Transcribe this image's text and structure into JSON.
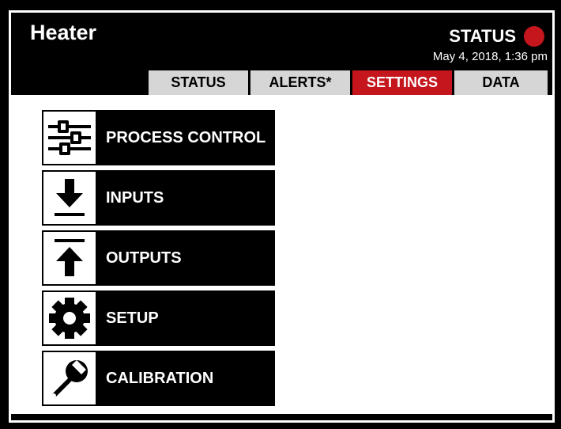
{
  "header": {
    "title": "Heater",
    "status_label": "STATUS",
    "status_color": "#c4161c",
    "datetime": "May 4, 2018, 1:36 pm"
  },
  "tabs": [
    {
      "label": "STATUS",
      "active": false
    },
    {
      "label": "ALERTS*",
      "active": false
    },
    {
      "label": "SETTINGS",
      "active": true
    },
    {
      "label": "DATA",
      "active": false
    }
  ],
  "menu": [
    {
      "label": "PROCESS CONTROL",
      "icon": "sliders-icon"
    },
    {
      "label": "INPUTS",
      "icon": "download-arrow-icon"
    },
    {
      "label": "OUTPUTS",
      "icon": "upload-arrow-icon"
    },
    {
      "label": "SETUP",
      "icon": "gear-icon"
    },
    {
      "label": "CALIBRATION",
      "icon": "wrench-icon"
    }
  ],
  "colors": {
    "accent": "#c4161c",
    "tab_inactive": "#d6d6d6",
    "background": "#000000"
  }
}
